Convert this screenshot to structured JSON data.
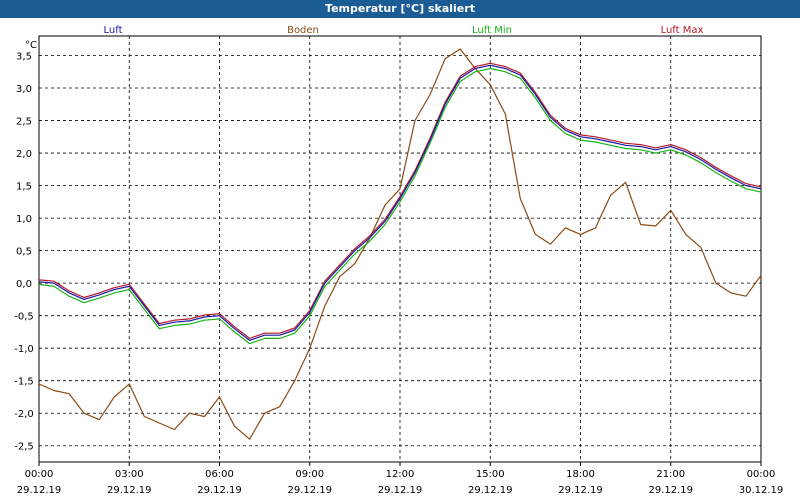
{
  "window": {
    "title": "Temperatur [°C] skaliert"
  },
  "colors": {
    "titlebar": "#1c5c95",
    "grid": "#000000",
    "luft": "#1a1aa6",
    "boden": "#8b4a13",
    "luft_min": "#19b319",
    "luft_max": "#b31a2a"
  },
  "chart_data": {
    "type": "line",
    "title": "Temperatur [°C] skaliert",
    "ylabel": "°C",
    "ylim": [
      -2.75,
      3.8
    ],
    "yticks": [
      "3,5",
      "3,0",
      "2,5",
      "2,0",
      "1,5",
      "1,0",
      "0,5",
      "0,0",
      "-0,5",
      "-1,0",
      "-1,5",
      "-2,0",
      "-2,5"
    ],
    "ytick_values": [
      3.5,
      3.0,
      2.5,
      2.0,
      1.5,
      1.0,
      0.5,
      0.0,
      -0.5,
      -1.0,
      -1.5,
      -2.0,
      -2.5
    ],
    "xlim": [
      0,
      24
    ],
    "xtick_hours": [
      0,
      3,
      6,
      9,
      12,
      15,
      18,
      21,
      24
    ],
    "xtick_times": [
      "00:00",
      "03:00",
      "06:00",
      "09:00",
      "12:00",
      "15:00",
      "18:00",
      "21:00",
      "00:00"
    ],
    "xtick_dates": [
      "29.12.19",
      "29.12.19",
      "29.12.19",
      "29.12.19",
      "29.12.19",
      "29.12.19",
      "29.12.19",
      "29.12.19",
      "30.12.19"
    ],
    "grid": true,
    "legend_placement": "top",
    "x": [
      0,
      0.5,
      1,
      1.5,
      2,
      2.5,
      3,
      3.5,
      4,
      4.5,
      5,
      5.5,
      6,
      6.5,
      7,
      7.5,
      8,
      8.5,
      9,
      9.5,
      10,
      10.5,
      11,
      11.5,
      12,
      12.5,
      13,
      13.5,
      14,
      14.5,
      15,
      15.5,
      16,
      16.5,
      17,
      17.5,
      18,
      18.5,
      19,
      19.5,
      20,
      20.5,
      21,
      21.5,
      22,
      22.5,
      23,
      23.5,
      24
    ],
    "series": [
      {
        "name": "Luft",
        "values": [
          0.02,
          0.0,
          -0.15,
          -0.25,
          -0.18,
          -0.1,
          -0.05,
          -0.35,
          -0.65,
          -0.6,
          -0.58,
          -0.52,
          -0.5,
          -0.7,
          -0.88,
          -0.8,
          -0.8,
          -0.72,
          -0.45,
          0.0,
          0.25,
          0.5,
          0.7,
          0.95,
          1.3,
          1.7,
          2.2,
          2.75,
          3.15,
          3.3,
          3.35,
          3.3,
          3.2,
          2.9,
          2.55,
          2.35,
          2.25,
          2.22,
          2.17,
          2.12,
          2.1,
          2.05,
          2.1,
          2.02,
          1.9,
          1.75,
          1.62,
          1.5,
          1.45
        ]
      },
      {
        "name": "Boden",
        "values": [
          -1.55,
          -1.65,
          -1.7,
          -2.0,
          -2.1,
          -1.75,
          -1.55,
          -2.05,
          -2.15,
          -2.25,
          -2.0,
          -2.05,
          -1.75,
          -2.2,
          -2.4,
          -2.0,
          -1.9,
          -1.5,
          -1.0,
          -0.35,
          0.1,
          0.3,
          0.7,
          1.2,
          1.45,
          2.5,
          2.9,
          3.45,
          3.6,
          3.3,
          3.05,
          2.6,
          1.3,
          0.75,
          0.6,
          0.85,
          0.75,
          0.85,
          1.35,
          1.55,
          0.9,
          0.88,
          1.12,
          0.75,
          0.55,
          0.0,
          -0.15,
          -0.2,
          0.12
        ]
      },
      {
        "name": "Luft Min",
        "values": [
          -0.02,
          -0.05,
          -0.2,
          -0.3,
          -0.23,
          -0.15,
          -0.1,
          -0.4,
          -0.7,
          -0.65,
          -0.63,
          -0.57,
          -0.55,
          -0.75,
          -0.93,
          -0.85,
          -0.85,
          -0.77,
          -0.5,
          -0.05,
          0.2,
          0.45,
          0.65,
          0.9,
          1.25,
          1.65,
          2.15,
          2.7,
          3.1,
          3.25,
          3.3,
          3.25,
          3.15,
          2.85,
          2.5,
          2.3,
          2.2,
          2.17,
          2.12,
          2.07,
          2.05,
          2.0,
          2.05,
          1.97,
          1.85,
          1.7,
          1.57,
          1.45,
          1.4
        ]
      },
      {
        "name": "Luft Max",
        "values": [
          0.05,
          0.03,
          -0.12,
          -0.22,
          -0.15,
          -0.07,
          -0.02,
          -0.32,
          -0.62,
          -0.57,
          -0.55,
          -0.49,
          -0.47,
          -0.67,
          -0.85,
          -0.77,
          -0.77,
          -0.69,
          -0.42,
          0.03,
          0.28,
          0.53,
          0.73,
          0.98,
          1.33,
          1.73,
          2.23,
          2.78,
          3.18,
          3.33,
          3.38,
          3.33,
          3.23,
          2.93,
          2.58,
          2.38,
          2.28,
          2.25,
          2.2,
          2.15,
          2.13,
          2.08,
          2.13,
          2.05,
          1.93,
          1.78,
          1.65,
          1.53,
          1.48
        ]
      }
    ]
  }
}
